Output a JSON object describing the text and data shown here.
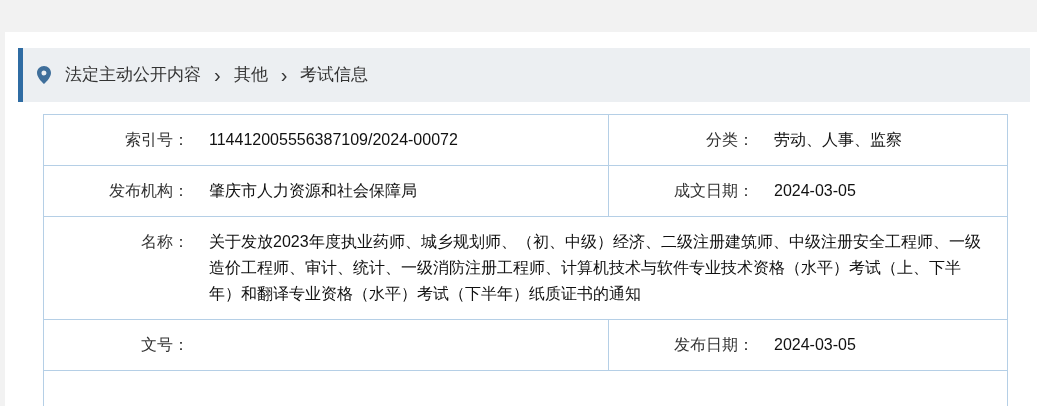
{
  "breadcrumb": [
    "法定主动公开内容",
    "其他",
    "考试信息"
  ],
  "separator": "›",
  "rows": [
    {
      "kind": "pair",
      "cells": [
        {
          "label": "索引号：",
          "value": "114412005556387109/2024-00072"
        },
        {
          "label": "分类：",
          "value": "劳动、人事、监察"
        }
      ]
    },
    {
      "kind": "pair",
      "cells": [
        {
          "label": "发布机构：",
          "value": "肇庆市人力资源和社会保障局"
        },
        {
          "label": "成文日期：",
          "value": "2024-03-05"
        }
      ]
    },
    {
      "kind": "wide",
      "cells": [
        {
          "label": "名称：",
          "value": "关于发放2023年度执业药师、城乡规划师、（初、中级）经济、二级注册建筑师、中级注册安全工程师、一级造价工程师、审计、统计、一级消防注册工程师、计算机技术与软件专业技术资格（水平）考试（上、下半年）和翻译专业资格（水平）考试（下半年）纸质证书的通知"
        }
      ]
    },
    {
      "kind": "pair",
      "cells": [
        {
          "label": "文号："
        },
        {
          "label": "发布日期：",
          "value": "2024-03-05"
        }
      ]
    },
    {
      "kind": "empty"
    }
  ]
}
